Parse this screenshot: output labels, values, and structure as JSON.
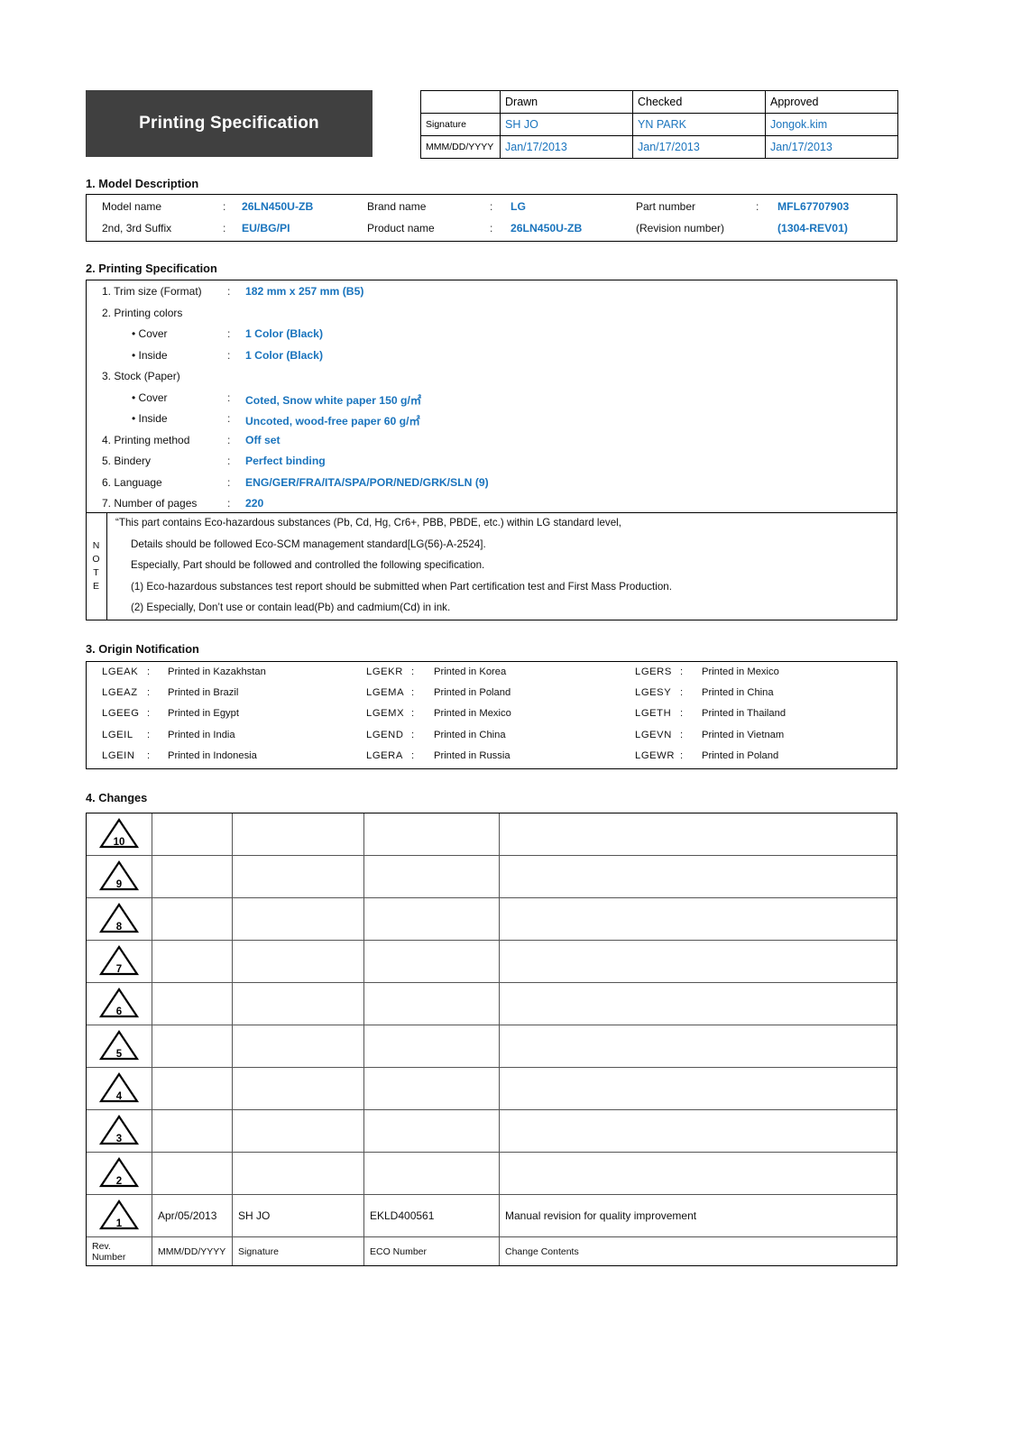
{
  "header": {
    "banner_title": "Printing Specification",
    "approval_columns": [
      "",
      "Drawn",
      "Checked",
      "Approved"
    ],
    "rows": [
      {
        "label": "Signature",
        "values": [
          "SH JO",
          "YN PARK",
          "Jongok.kim"
        ]
      },
      {
        "label": "MMM/DD/YYYY",
        "values": [
          "Jan/17/2013",
          "Jan/17/2013",
          "Jan/17/2013"
        ]
      }
    ]
  },
  "section1": {
    "title": "1. Model Description",
    "rows": [
      [
        {
          "label": "Model name",
          "colon": ":",
          "value": "26LN450U-ZB"
        },
        {
          "label": "Brand name",
          "colon": ":",
          "value": "LG"
        },
        {
          "label": "Part number",
          "colon": ":",
          "value": "MFL67707903"
        }
      ],
      [
        {
          "label": "2nd, 3rd Suffix",
          "colon": ":",
          "value": "EU/BG/PI"
        },
        {
          "label": "Product name",
          "colon": ":",
          "value": "26LN450U-ZB"
        },
        {
          "label": "(Revision number)",
          "colon": "",
          "value": "(1304-REV01)"
        }
      ]
    ]
  },
  "section2": {
    "title": "2. Printing Specification",
    "items": [
      {
        "label": "1. Trim size (Format)",
        "colon": ":",
        "value": "182 mm x 257 mm (B5)",
        "indent": 0
      },
      {
        "label": "2. Printing colors",
        "colon": "",
        "value": "",
        "indent": 0
      },
      {
        "label": "• Cover",
        "colon": ":",
        "value": "1 Color (Black)",
        "indent": 1
      },
      {
        "label": "• Inside",
        "colon": ":",
        "value": "1 Color (Black)",
        "indent": 1
      },
      {
        "label": "3. Stock (Paper)",
        "colon": "",
        "value": "",
        "indent": 0
      },
      {
        "label": "• Cover",
        "colon": ":",
        "value": "Coted, Snow white paper 150 g/㎡",
        "indent": 1
      },
      {
        "label": "• Inside",
        "colon": ":",
        "value": "Uncoted, wood-free paper 60 g/㎡",
        "indent": 1
      },
      {
        "label": "4. Printing method",
        "colon": ":",
        "value": "Off set",
        "indent": 0
      },
      {
        "label": "5. Bindery",
        "colon": ":",
        "value": "Perfect binding",
        "indent": 0
      },
      {
        "label": "6. Language",
        "colon": ":",
        "value": "ENG/GER/FRA/ITA/SPA/POR/NED/GRK/SLN (9)",
        "indent": 0
      },
      {
        "label": "7. Number of pages",
        "colon": ":",
        "value": "220",
        "indent": 0
      }
    ],
    "note": {
      "side_label": "NOTE",
      "lines": [
        {
          "text": "“This part contains Eco-hazardous substances (Pb, Cd, Hg, Cr6+, PBB, PBDE, etc.) within LG standard level,",
          "indent": 0
        },
        {
          "text": "Details should be followed Eco-SCM management standard[LG(56)-A-2524].",
          "indent": 1
        },
        {
          "text": "Especially, Part should be followed and controlled the following specification.",
          "indent": 1
        },
        {
          "text": "(1) Eco-hazardous substances test report should be submitted when Part certification test and First Mass Production.",
          "indent": 1
        },
        {
          "text": "(2) Especially, Don’t use or contain lead(Pb) and cadmium(Cd) in ink.",
          "indent": 1
        }
      ]
    }
  },
  "section3": {
    "title": "3. Origin Notification",
    "columns": [
      [
        {
          "code": "LGEAK",
          "colon": ":",
          "text": "Printed in Kazakhstan"
        },
        {
          "code": "LGEAZ",
          "colon": ":",
          "text": "Printed in Brazil"
        },
        {
          "code": "LGEEG",
          "colon": ":",
          "text": "Printed in Egypt"
        },
        {
          "code": "LGEIL",
          "colon": ":",
          "text": "Printed in India"
        },
        {
          "code": "LGEIN",
          "colon": ":",
          "text": "Printed in Indonesia"
        }
      ],
      [
        {
          "code": "LGEKR",
          "colon": ":",
          "text": "Printed in Korea"
        },
        {
          "code": "LGEMA",
          "colon": ":",
          "text": "Printed in Poland"
        },
        {
          "code": "LGEMX",
          "colon": ":",
          "text": "Printed in Mexico"
        },
        {
          "code": "LGEND",
          "colon": ":",
          "text": "Printed in China"
        },
        {
          "code": "LGERA",
          "colon": ":",
          "text": "Printed in Russia"
        }
      ],
      [
        {
          "code": "LGERS",
          "colon": ":",
          "text": "Printed in Mexico"
        },
        {
          "code": "LGESY",
          "colon": ":",
          "text": "Printed in China"
        },
        {
          "code": "LGETH",
          "colon": ":",
          "text": "Printed in Thailand"
        },
        {
          "code": "LGEVN",
          "colon": ":",
          "text": "Printed in Vietnam"
        },
        {
          "code": "LGEWR",
          "colon": ":",
          "text": "Printed in Poland"
        }
      ]
    ]
  },
  "section4": {
    "title": "4. Changes",
    "rows": [
      {
        "rev": "10",
        "date": "",
        "signature": "",
        "eco": "",
        "contents": ""
      },
      {
        "rev": "9",
        "date": "",
        "signature": "",
        "eco": "",
        "contents": ""
      },
      {
        "rev": "8",
        "date": "",
        "signature": "",
        "eco": "",
        "contents": ""
      },
      {
        "rev": "7",
        "date": "",
        "signature": "",
        "eco": "",
        "contents": ""
      },
      {
        "rev": "6",
        "date": "",
        "signature": "",
        "eco": "",
        "contents": ""
      },
      {
        "rev": "5",
        "date": "",
        "signature": "",
        "eco": "",
        "contents": ""
      },
      {
        "rev": "4",
        "date": "",
        "signature": "",
        "eco": "",
        "contents": ""
      },
      {
        "rev": "3",
        "date": "",
        "signature": "",
        "eco": "",
        "contents": ""
      },
      {
        "rev": "2",
        "date": "",
        "signature": "",
        "eco": "",
        "contents": ""
      },
      {
        "rev": "1",
        "date": "Apr/05/2013",
        "signature": "SH JO",
        "eco": "EKLD400561",
        "contents": "Manual revision for quality improvement"
      }
    ],
    "footer": {
      "rev": "Rev. Number",
      "date": "MMM/DD/YYYY",
      "signature": "Signature",
      "eco": "ECO Number",
      "contents": "Change Contents"
    }
  },
  "colors": {
    "banner_bg": "#404040",
    "accent_blue": "#1a74bd",
    "border": "#000000"
  }
}
